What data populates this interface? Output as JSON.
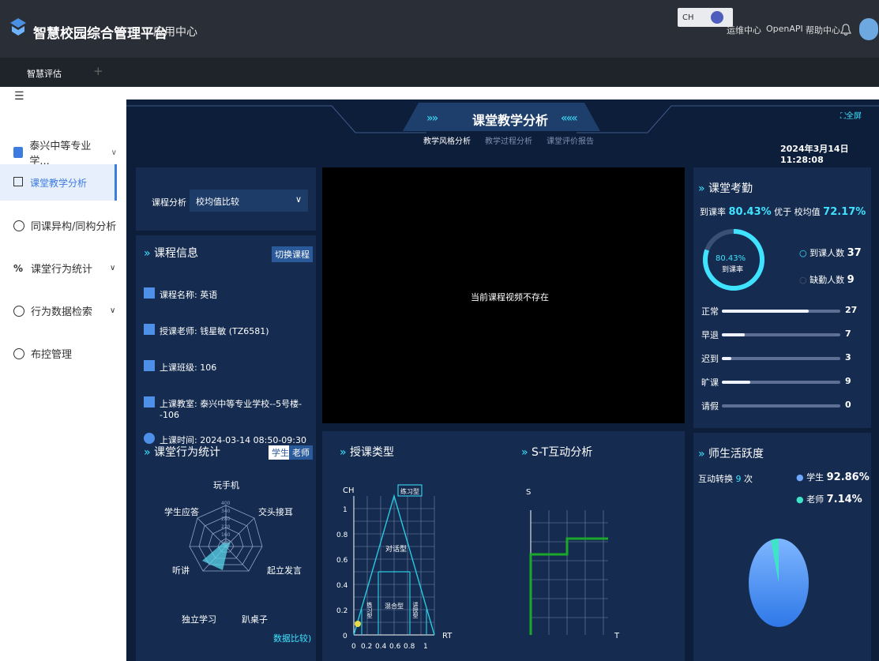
{
  "topbar": {
    "app_title": "智慧校园综合管理平台",
    "app_center": "应用中心",
    "ime_label": "CH",
    "right_links": [
      "运维中心",
      "OpenAPI",
      "帮助中心"
    ]
  },
  "tabs": {
    "active": "智慧评估",
    "add": "+"
  },
  "sidebar": {
    "collapse_icon": "☰",
    "school": "泰兴中等专业学...",
    "items": [
      "课堂教学分析",
      "同课异构/同构分析",
      "课堂行为统计",
      "行为数据检索",
      "布控管理"
    ]
  },
  "header": {
    "title": "课堂教学分析",
    "left_arrows": "»»",
    "right_arrows": "«««",
    "fullscreen": "全屏",
    "datetime": "2024年3月14日 11:28:08",
    "subtabs": [
      "教学风格分析",
      "教学过程分析",
      "课堂评价报告"
    ]
  },
  "filter": {
    "label": "课程分析",
    "value": "校均值比较",
    "chevron": "∨"
  },
  "course_info": {
    "title": "课程信息",
    "switch_btn": "切换课程",
    "name": "课程名称: 英语",
    "teacher": "授课老师: 钱星敏 (TZ6581)",
    "class": "上课班级: 106",
    "room": "上课教室: 泰兴中等专业学校--5号楼--106",
    "time": "上课时间: 2024-03-14 08:50-09:30"
  },
  "video": {
    "message": "当前课程视频不存在"
  },
  "behavior": {
    "title": "课堂行为统计",
    "toggle_student": "学生",
    "toggle_teacher": "老师",
    "labels": [
      "玩手机",
      "交头接耳",
      "起立发言",
      "趴桌子",
      "独立学习",
      "听讲",
      "学生应答"
    ],
    "scale": [
      "400",
      "340",
      "280",
      "220",
      "160",
      "100"
    ],
    "footer": "数据比较)"
  },
  "teach_type": {
    "title": "授课类型",
    "y_label": "CH",
    "x_label": "RT",
    "y_ticks": [
      "0",
      "0.2",
      "0.4",
      "0.6",
      "0.8",
      "1"
    ],
    "x_ticks": [
      "0",
      "0.2",
      "0.4",
      "0.6",
      "0.8",
      "1"
    ],
    "regions": [
      "练习型",
      "对话型",
      "混合型",
      "练习型",
      "讲授型"
    ]
  },
  "st": {
    "title": "S-T互动分析",
    "y_label": "S",
    "x_label": "T"
  },
  "attendance": {
    "title": "课堂考勤",
    "rate_prefix": "到课率",
    "rate": "80.43%",
    "better": "优于",
    "avg_label": "校均值",
    "avg": "72.17%",
    "ring_value": "80.43%",
    "ring_label": "到课率",
    "present_label": "到课人数",
    "present": "37",
    "absent_label": "缺勤人数",
    "absent": "9",
    "rows": [
      {
        "label": "正常",
        "value": "27",
        "fraction": 0.73
      },
      {
        "label": "早退",
        "value": "7",
        "fraction": 0.19
      },
      {
        "label": "迟到",
        "value": "3",
        "fraction": 0.08
      },
      {
        "label": "旷课",
        "value": "9",
        "fraction": 0.24
      },
      {
        "label": "请假",
        "value": "0",
        "fraction": 0
      }
    ]
  },
  "activity": {
    "title": "师生活跃度",
    "switch_label": "互动转换",
    "switch_count": "9",
    "switch_unit": "次",
    "student_label": "学生",
    "student_value": "92.86%",
    "teacher_label": "老师",
    "teacher_value": "7.14%"
  },
  "colors": {
    "accent": "#3fe3ff",
    "panel": "#152c50",
    "main_bg": "#0d1e3b"
  }
}
